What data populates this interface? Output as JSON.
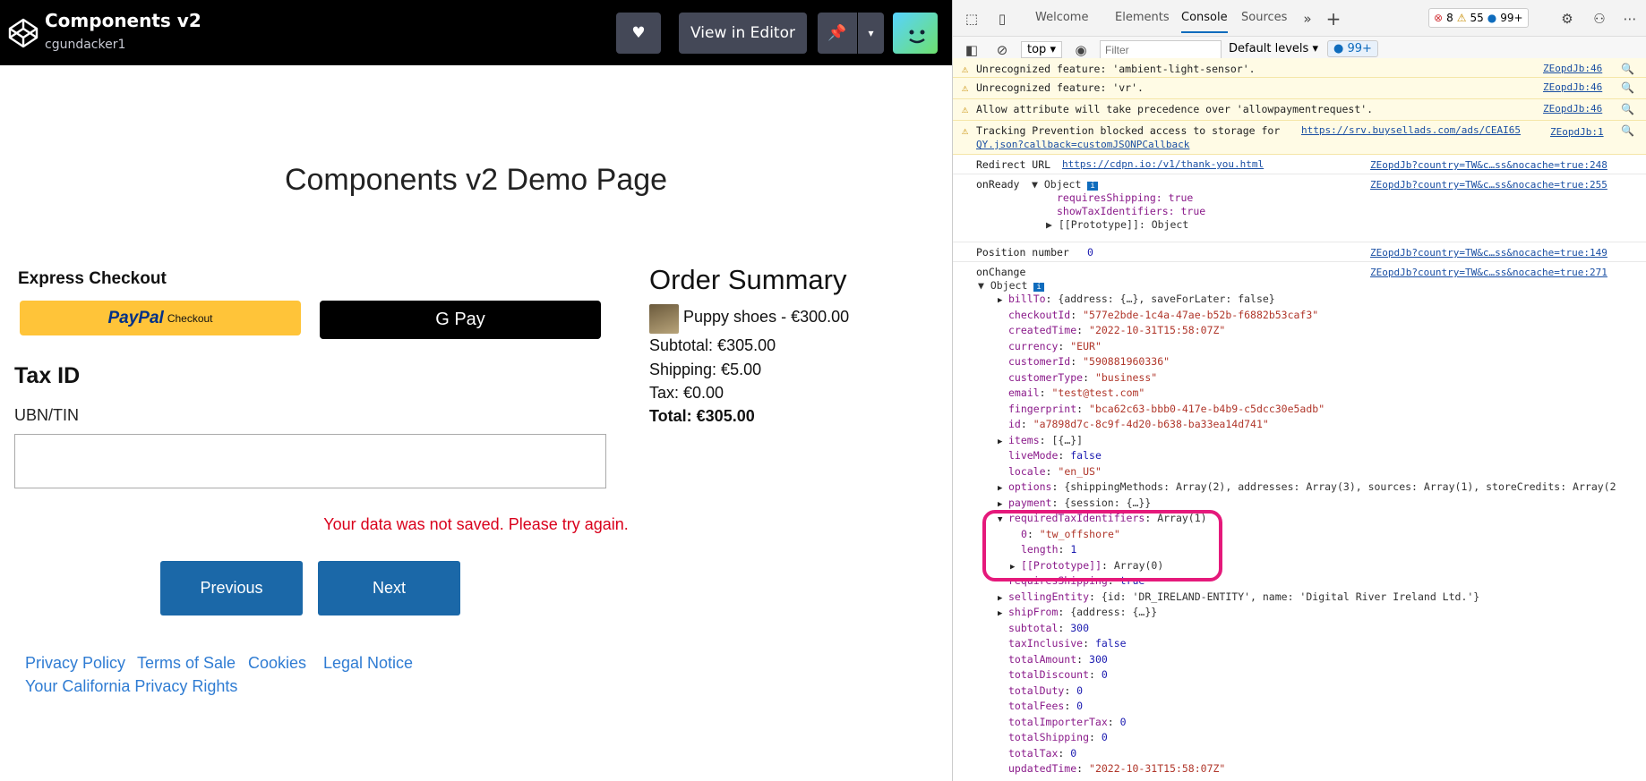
{
  "app": {
    "title": "Components v2",
    "user": "cgundacker1",
    "view_in_editor": "View in Editor"
  },
  "page": {
    "title": "Components v2 Demo Page",
    "express_checkout": "Express Checkout",
    "paypal_text": "PayPal",
    "paypal_checkout": "Checkout",
    "gpay_text": "G Pay",
    "tax_heading": "Tax ID",
    "ubn_label": "UBN/TIN",
    "ubn_value": "",
    "error": "Your data was not saved. Please try again.",
    "previous": "Previous",
    "next": "Next",
    "footer": [
      "Privacy Policy",
      "Terms of Sale",
      "Cookies",
      "Legal Notice",
      "Your California Privacy Rights"
    ]
  },
  "order": {
    "title": "Order Summary",
    "item": "Puppy shoes - €300.00",
    "subtotal": "Subtotal: €305.00",
    "shipping": "Shipping: €5.00",
    "tax": "Tax: €0.00",
    "total": "Total: €305.00"
  },
  "devtools": {
    "tabs": [
      "Welcome",
      "Elements",
      "Console",
      "Sources"
    ],
    "errors": "8",
    "warnings": "55",
    "messages": "99+",
    "context": "top",
    "filter_placeholder": "Filter",
    "levels": "Default levels",
    "issues": "99+",
    "lines": [
      {
        "text": "Unrecognized feature: 'ambient-light-sensor'.",
        "src": "ZEopdJb:46"
      },
      {
        "text": "Unrecognized feature: 'vr'.",
        "src": "ZEopdJb:46"
      },
      {
        "text": "Allow attribute will take precedence over 'allowpaymentrequest'.",
        "src": "ZEopdJb:46"
      },
      {
        "text": "Tracking Prevention blocked access to storage for",
        "link": "https://srv.buysellads.com/ads/CEAI65",
        "link2": "QY.json?callback=customJSONPCallback",
        "src": "ZEopdJb:1"
      }
    ],
    "redirect": {
      "label": "Redirect URL",
      "url": "https://cdpn.io:/v1/thank-you.html",
      "src": "ZEopdJb?country=TW&c…ss&nocache=true:248"
    },
    "onready": {
      "label": "onReady",
      "obj": "Object",
      "requiresShipping": "requiresShipping: true",
      "showTax": "showTaxIdentifiers: true",
      "proto": "[[Prototype]]: Object",
      "src": "ZEopdJb?country=TW&c…ss&nocache=true:255"
    },
    "position": {
      "label": "Position number",
      "value": "0",
      "src": "ZEopdJb?country=TW&c…ss&nocache=true:149"
    },
    "onchange": {
      "label": "onChange",
      "obj": "Object",
      "src": "ZEopdJb?country=TW&c…ss&nocache=true:271"
    },
    "props": [
      {
        "k": "billTo",
        "v": "{address: {…}, saveForLater: false}",
        "tri": true
      },
      {
        "k": "checkoutId",
        "v": "\"577e2bde-1c4a-47ae-b52b-f6882b53caf3\"",
        "s": true
      },
      {
        "k": "createdTime",
        "v": "\"2022-10-31T15:58:07Z\"",
        "s": true
      },
      {
        "k": "currency",
        "v": "\"EUR\"",
        "s": true
      },
      {
        "k": "customerId",
        "v": "\"590881960336\"",
        "s": true
      },
      {
        "k": "customerType",
        "v": "\"business\"",
        "s": true
      },
      {
        "k": "email",
        "v": "\"test@test.com\"",
        "s": true
      },
      {
        "k": "fingerprint",
        "v": "\"bca62c63-bbb0-417e-b4b9-c5dcc30e5adb\"",
        "s": true
      },
      {
        "k": "id",
        "v": "\"a7898d7c-8c9f-4d20-b638-ba33ea14d741\"",
        "s": true
      },
      {
        "k": "items",
        "v": "[{…}]",
        "tri": true
      },
      {
        "k": "liveMode",
        "v": "false"
      },
      {
        "k": "locale",
        "v": "\"en_US\"",
        "s": true
      },
      {
        "k": "options",
        "v": "{shippingMethods: Array(2), addresses: Array(3), sources: Array(1), storeCredits: Array(2",
        "tri": true
      },
      {
        "k": "payment",
        "v": "{session: {…}}",
        "tri": true
      },
      {
        "k": "requiredTaxIdentifiers",
        "v": "Array(1)",
        "open": true
      },
      {
        "k": "0",
        "v": "\"tw_offshore\"",
        "s": true,
        "d": 2
      },
      {
        "k": "length",
        "v": "1",
        "d": 2
      },
      {
        "k": "[[Prototype]]",
        "v": "Array(0)",
        "tri": true,
        "d": 2
      },
      {
        "k": "requiresShipping",
        "v": "true"
      },
      {
        "k": "sellingEntity",
        "v": "{id: 'DR_IRELAND-ENTITY', name: 'Digital River Ireland Ltd.'}",
        "tri": true
      },
      {
        "k": "shipFrom",
        "v": "{address: {…}}",
        "tri": true
      },
      {
        "k": "subtotal",
        "v": "300"
      },
      {
        "k": "taxInclusive",
        "v": "false"
      },
      {
        "k": "totalAmount",
        "v": "300"
      },
      {
        "k": "totalDiscount",
        "v": "0"
      },
      {
        "k": "totalDuty",
        "v": "0"
      },
      {
        "k": "totalFees",
        "v": "0"
      },
      {
        "k": "totalImporterTax",
        "v": "0"
      },
      {
        "k": "totalShipping",
        "v": "0"
      },
      {
        "k": "totalTax",
        "v": "0"
      },
      {
        "k": "updatedTime",
        "v": "\"2022-10-31T15:58:07Z\"",
        "s": true
      }
    ]
  },
  "colors": {
    "highlight": "#e5197b",
    "paypal": "#ffc439",
    "primary": "#1b68a8",
    "error": "#d9001b"
  }
}
